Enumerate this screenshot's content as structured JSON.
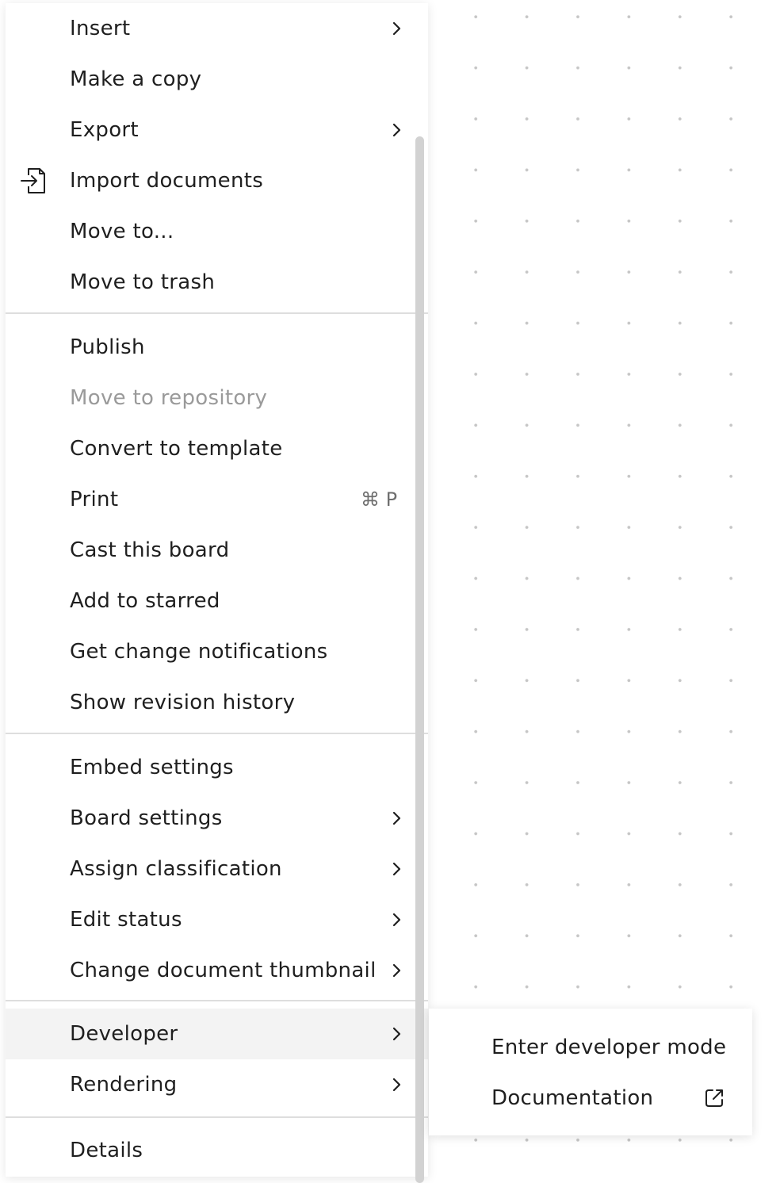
{
  "menu": {
    "items": [
      {
        "label": "Insert"
      },
      {
        "label": "Make a copy"
      },
      {
        "label": "Export"
      },
      {
        "label": "Import documents",
        "icon": "import-file-icon"
      },
      {
        "label": "Move to..."
      },
      {
        "label": "Move to trash"
      },
      {
        "label": "Publish"
      },
      {
        "label": "Move to repository",
        "disabled": true
      },
      {
        "label": "Convert to template"
      },
      {
        "label": "Print",
        "shortcut": "⌘ P"
      },
      {
        "label": "Cast this board"
      },
      {
        "label": "Add to starred"
      },
      {
        "label": "Get change notifications"
      },
      {
        "label": "Show revision history"
      },
      {
        "label": "Embed settings"
      },
      {
        "label": "Board settings"
      },
      {
        "label": "Assign classification"
      },
      {
        "label": "Edit status"
      },
      {
        "label": "Change document thumbnail"
      },
      {
        "label": "Developer",
        "active": true
      },
      {
        "label": "Rendering"
      },
      {
        "label": "Details"
      }
    ]
  },
  "submenu": {
    "items": [
      {
        "label": "Enter developer mode"
      },
      {
        "label": "Documentation",
        "icon": "external-link-icon"
      }
    ]
  },
  "colors": {
    "background": "#ffffff",
    "dot_grid": "#c6c6c6",
    "text": "#1f1f1f",
    "disabled_text": "#9a9a9a",
    "hover_background": "#f3f3f3",
    "divider": "#dedede",
    "scrollbar": "#d2d2d2"
  }
}
